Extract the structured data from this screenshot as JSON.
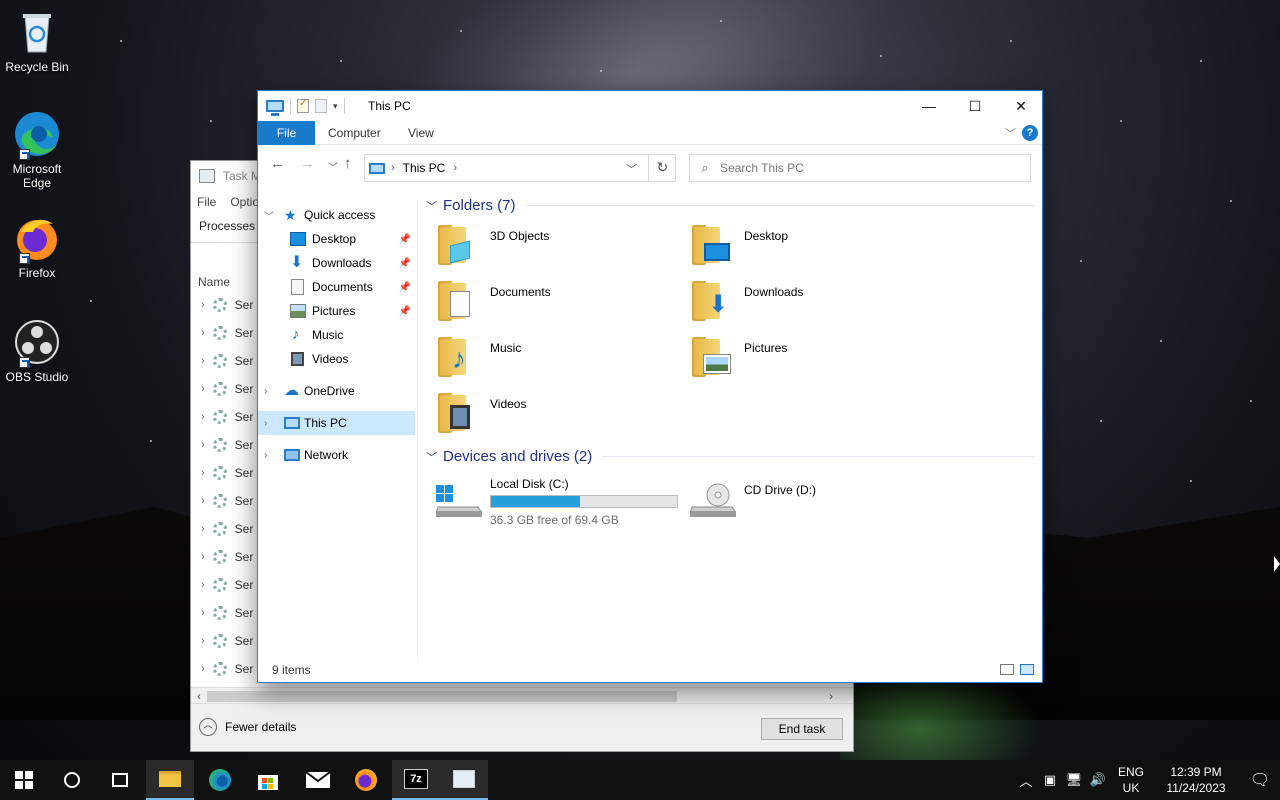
{
  "desktop": {
    "icons": [
      {
        "label": "Recycle Bin",
        "icon": "recycle-bin-icon"
      },
      {
        "label": "Microsoft Edge",
        "icon": "edge-icon"
      },
      {
        "label": "Firefox",
        "icon": "firefox-icon"
      },
      {
        "label": "OBS Studio",
        "icon": "obs-icon"
      }
    ]
  },
  "task_manager": {
    "title": "Task Ma",
    "menu": [
      "File",
      "Optio"
    ],
    "tab": "Processes",
    "column": "Name",
    "row_label": "Ser",
    "fewer_details": "Fewer details",
    "end_task": "End task"
  },
  "explorer": {
    "title": "This PC",
    "ribbon": {
      "file": "File",
      "computer": "Computer",
      "view": "View",
      "help": "?"
    },
    "address": {
      "crumb": "This PC",
      "search_placeholder": "Search This PC"
    },
    "nav": {
      "quick_access": "Quick access",
      "items": [
        "Desktop",
        "Downloads",
        "Documents",
        "Pictures",
        "Music",
        "Videos"
      ],
      "onedrive": "OneDrive",
      "this_pc": "This PC",
      "network": "Network"
    },
    "folders_header": "Folders (7)",
    "folders": [
      "3D Objects",
      "Desktop",
      "Documents",
      "Downloads",
      "Music",
      "Pictures",
      "Videos"
    ],
    "drives_header": "Devices and drives (2)",
    "drives": [
      {
        "name": "Local Disk (C:)",
        "free": "36.3 GB free of 69.4 GB",
        "used_fraction": 0.477
      },
      {
        "name": "CD Drive (D:)"
      }
    ],
    "status": "9 items"
  },
  "taskbar": {
    "lang_1": "ENG",
    "lang_2": "UK",
    "time": "12:39 PM",
    "date": "11/24/2023",
    "apps": [
      "start",
      "search",
      "task-view",
      "file-explorer",
      "edge",
      "store",
      "mail",
      "firefox",
      "7zip",
      "task-manager"
    ]
  },
  "colors": {
    "accent": "#1979ca",
    "selection": "#cce8ff",
    "progress": "#26a0da",
    "section": "#1e3287"
  }
}
